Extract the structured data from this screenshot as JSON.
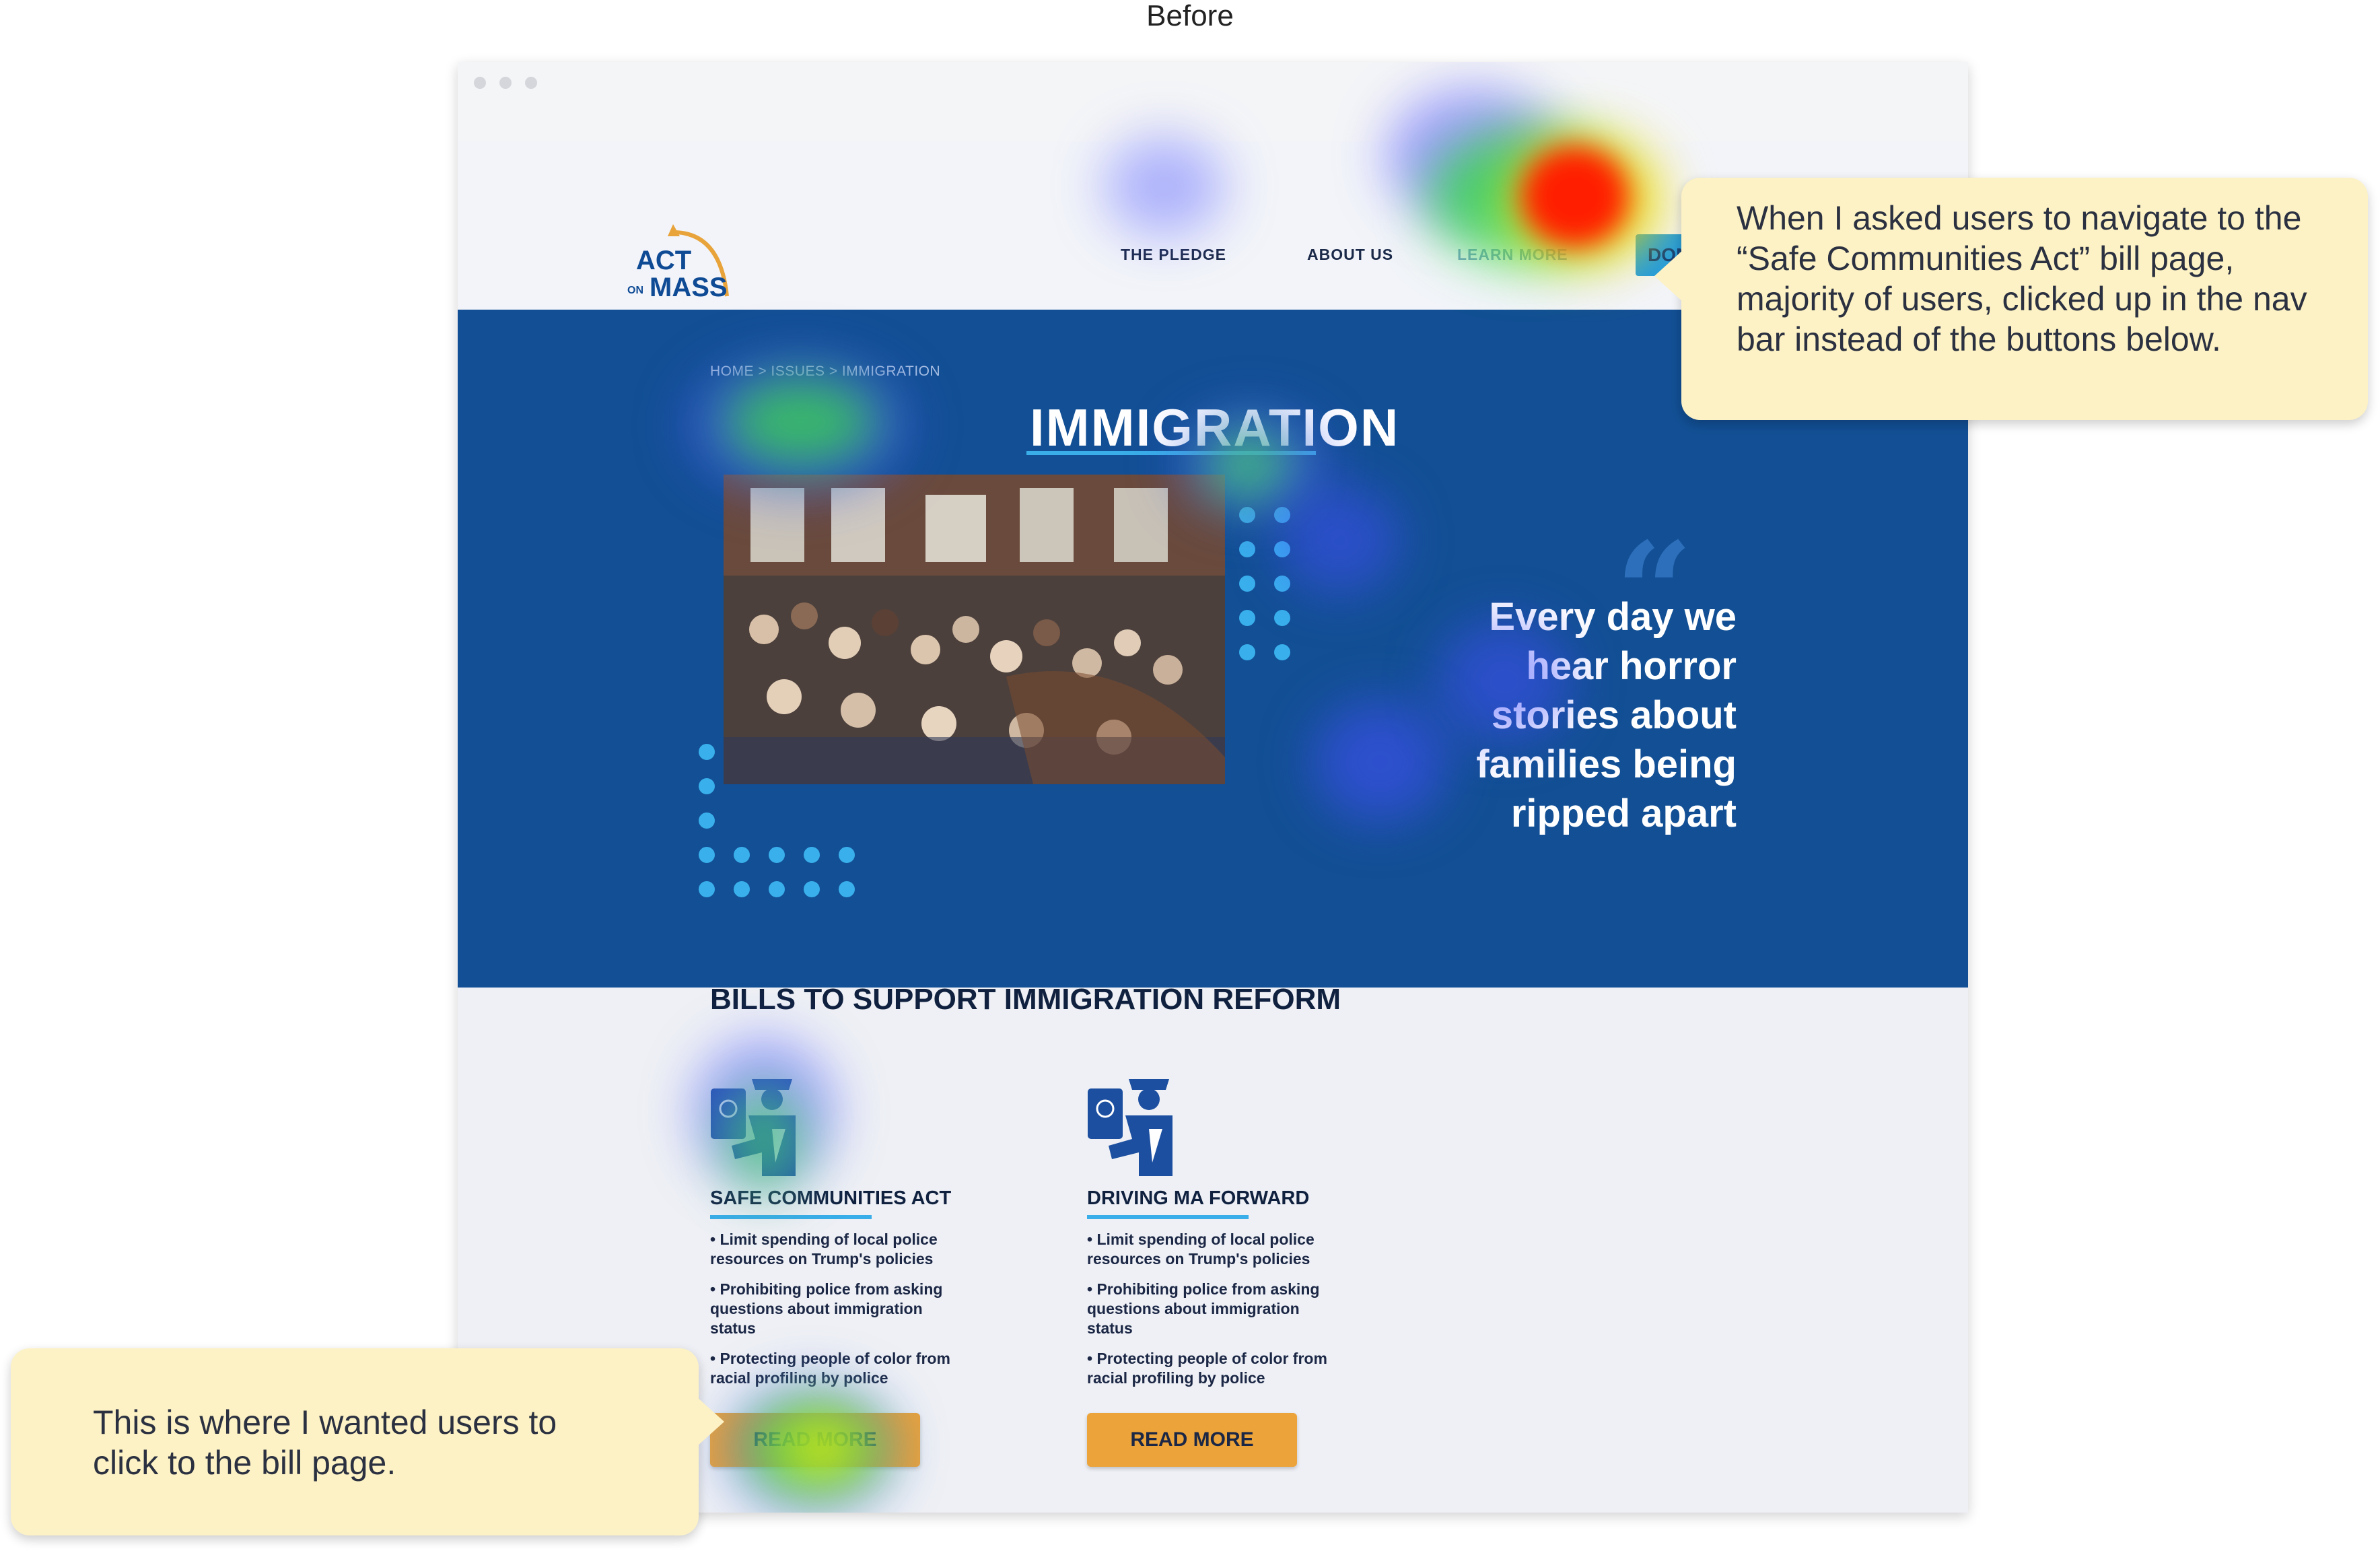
{
  "heading": "Before",
  "logo": {
    "line1": "ACT",
    "small": "ON",
    "line2": "MASS"
  },
  "nav": {
    "items": [
      "THE PLEDGE",
      "ABOUT US",
      "LEARN MORE"
    ],
    "donate": "DON"
  },
  "breadcrumb": "HOME > ISSUES > IMMIGRATION",
  "page_title": "IMMIGRATION",
  "quote": [
    "Every day we",
    "hear horror",
    "stories about",
    "families being",
    "ripped apart"
  ],
  "bills_heading": "BILLS TO SUPPORT IMMIGRATION REFORM",
  "bills": [
    {
      "title": "SAFE COMMUNITIES ACT",
      "bullets": [
        [
          "• Limit spending of local police",
          "resources on Trump's policies"
        ],
        [
          "• Prohibiting police from asking",
          "questions about immigration",
          "status"
        ],
        [
          "• Protecting people of color from",
          "racial profiling by police"
        ]
      ],
      "button": "READ MORE"
    },
    {
      "title": "DRIVING MA FORWARD",
      "bullets": [
        [
          "• Limit spending of local police",
          "resources on Trump's policies"
        ],
        [
          "• Prohibiting police from asking",
          "questions about immigration",
          "status"
        ],
        [
          "• Protecting people of color from",
          "racial profiling by police"
        ]
      ],
      "button": "READ MORE"
    }
  ],
  "callouts": {
    "top": "When I asked users to navigate to the “Safe Communities Act” bill page, majority of users, clicked up in the nav bar instead of the buttons below.",
    "bottom": "This is where I wanted users to click to the bill page."
  },
  "colors": {
    "hero": "#124f94",
    "accent": "#39aee8",
    "button": "#eba33a",
    "callout": "#fdf2c5"
  },
  "icons": [
    "passport-officer-icon",
    "quote-icon"
  ]
}
